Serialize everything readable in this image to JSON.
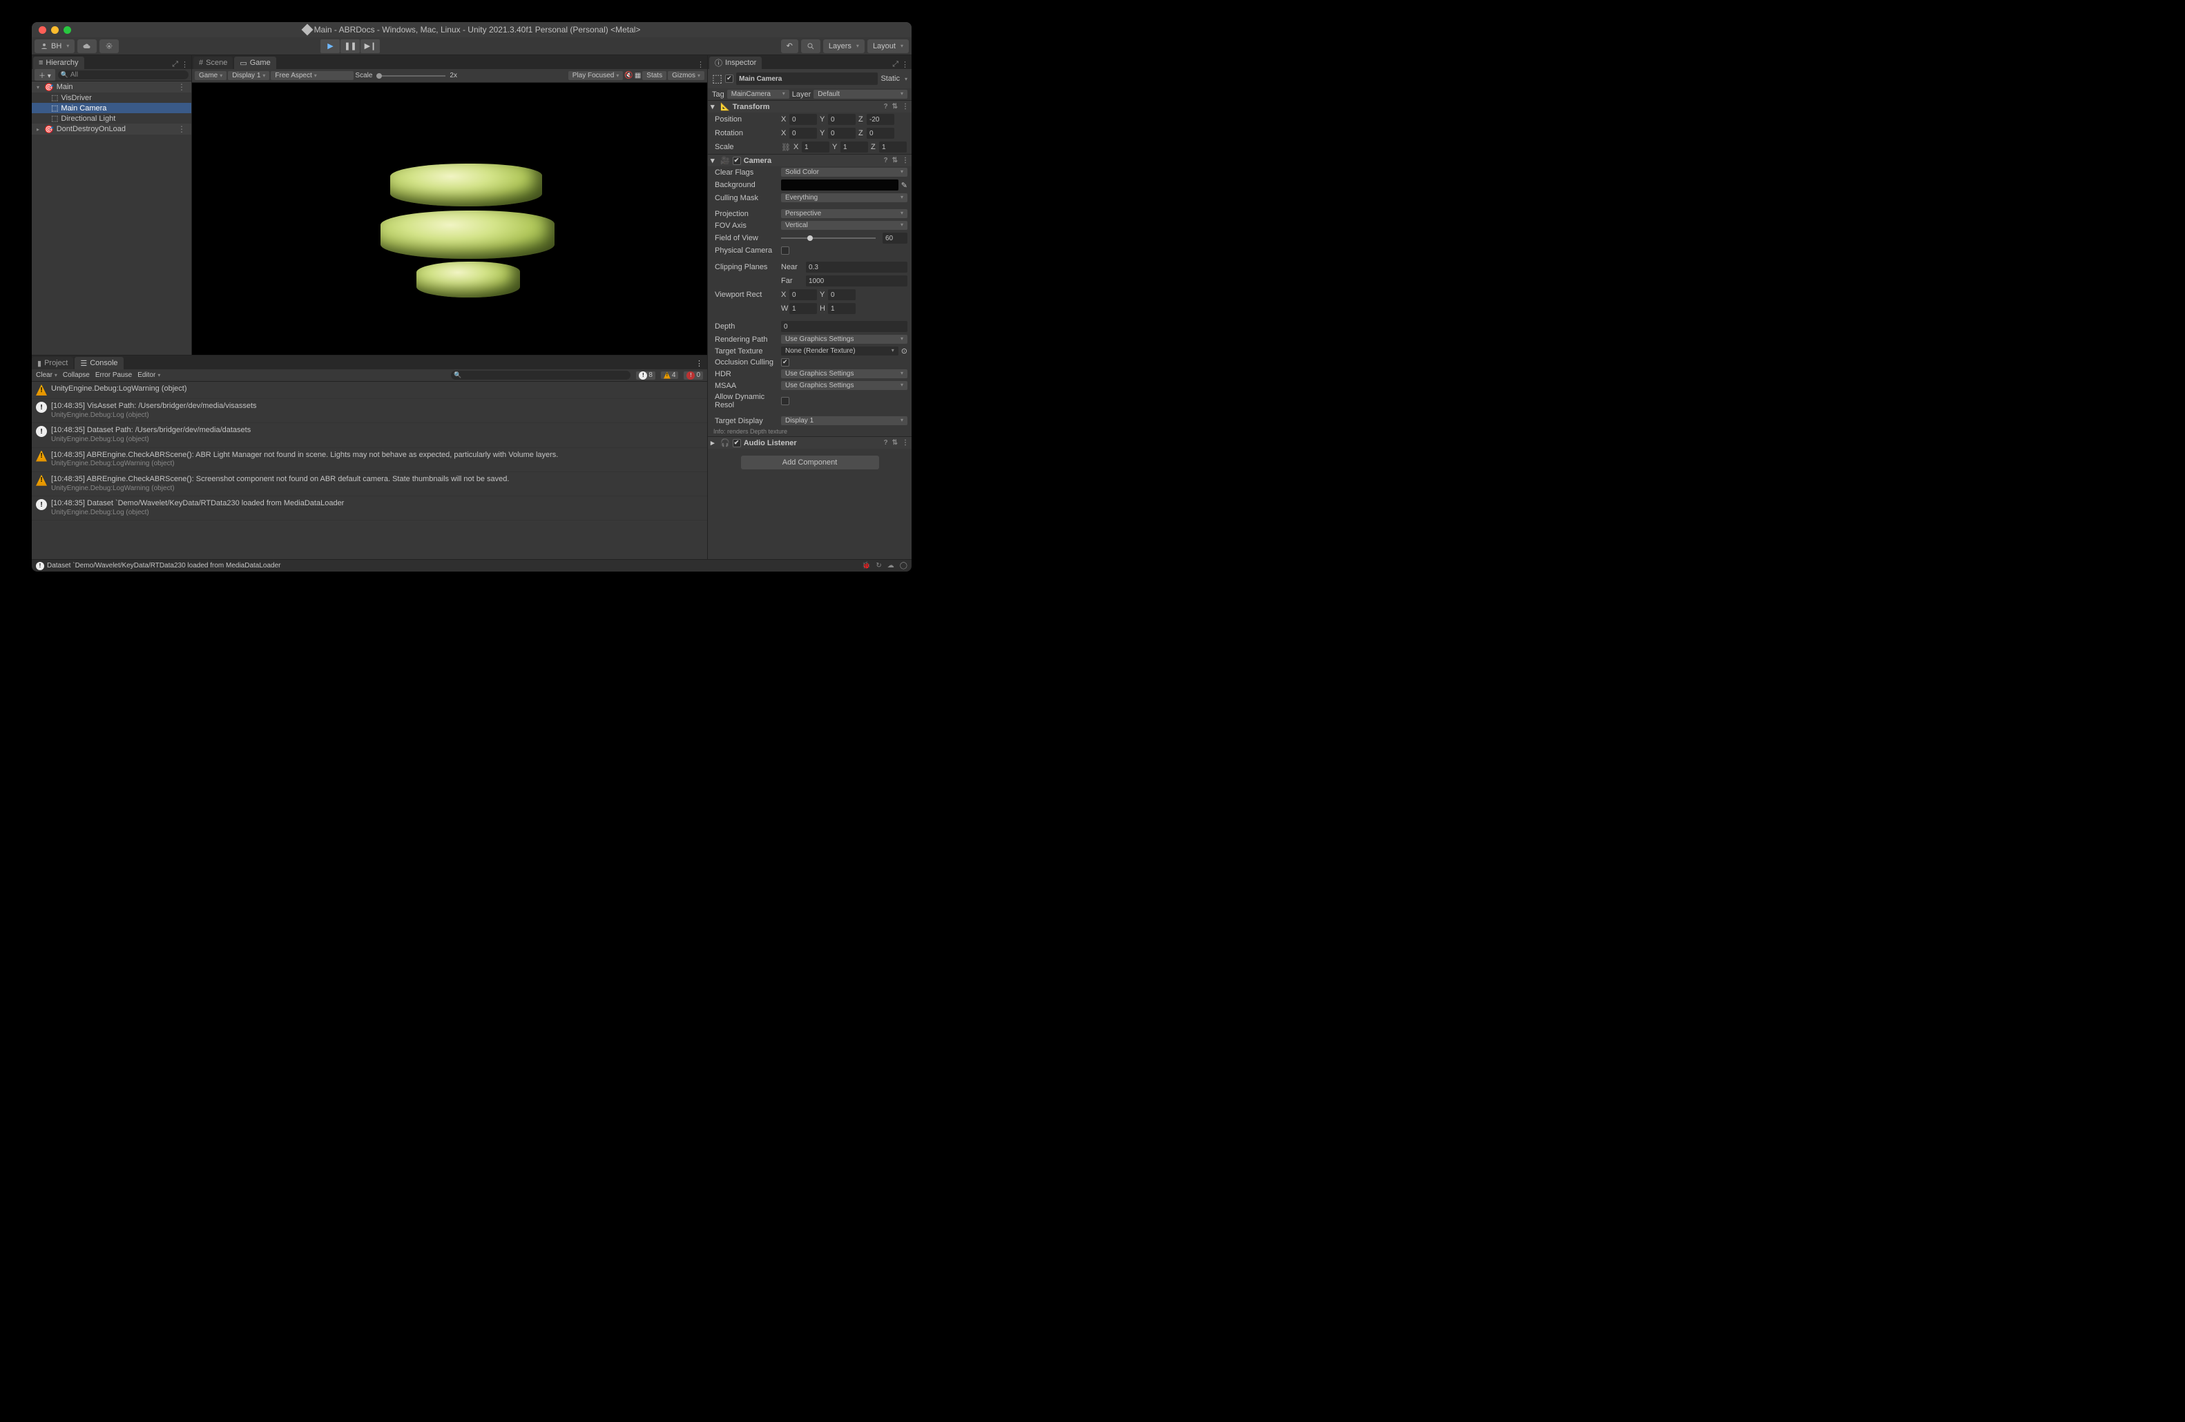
{
  "window": {
    "title": "Main - ABRDocs - Windows, Mac, Linux - Unity 2021.3.40f1 Personal (Personal) <Metal>"
  },
  "account": {
    "label": "BH"
  },
  "layers": "Layers",
  "layout": "Layout",
  "hierarchy": {
    "tab": "Hierarchy",
    "search_placeholder": "All",
    "items": [
      {
        "name": "Main",
        "kind": "scene"
      },
      {
        "name": "VisDriver",
        "indent": 1
      },
      {
        "name": "Main Camera",
        "indent": 1,
        "selected": true
      },
      {
        "name": "Directional Light",
        "indent": 1
      },
      {
        "name": "DontDestroyOnLoad",
        "kind": "scene-aux"
      }
    ]
  },
  "center": {
    "tabs": [
      {
        "label": "Scene",
        "active": false,
        "icon": "grid"
      },
      {
        "label": "Game",
        "active": true,
        "icon": "display"
      }
    ],
    "gamebar": {
      "mode": "Game",
      "display": "Display 1",
      "aspect": "Free Aspect",
      "scale_label": "Scale",
      "scale_value": "2x",
      "play_focus": "Play Focused",
      "stats": "Stats",
      "gizmos": "Gizmos"
    }
  },
  "bottom": {
    "tabs": [
      {
        "label": "Project",
        "active": false,
        "icon": "folder"
      },
      {
        "label": "Console",
        "active": true,
        "icon": "console"
      }
    ],
    "toolbar": {
      "clear": "Clear",
      "collapse": "Collapse",
      "error_pause": "Error Pause",
      "editor": "Editor",
      "counts": {
        "info": 8,
        "warn": 4,
        "err": 0
      }
    },
    "logs": [
      {
        "type": "warn",
        "line1": "UnityEngine.Debug:LogWarning (object)"
      },
      {
        "type": "info",
        "line1": "[10:48:35] VisAsset Path: /Users/bridger/dev/media/visassets",
        "line2": "UnityEngine.Debug:Log (object)"
      },
      {
        "type": "info",
        "line1": "[10:48:35] Dataset Path: /Users/bridger/dev/media/datasets",
        "line2": "UnityEngine.Debug:Log (object)"
      },
      {
        "type": "warn",
        "line1": "[10:48:35] ABREngine.CheckABRScene(): ABR Light Manager not found in scene. Lights may not behave as expected, particularly with Volume layers.",
        "line2": "UnityEngine.Debug:LogWarning (object)"
      },
      {
        "type": "warn",
        "line1": "[10:48:35] ABREngine.CheckABRScene(): Screenshot component not found on ABR default camera. State thumbnails will not be saved.",
        "line2": "UnityEngine.Debug:LogWarning (object)"
      },
      {
        "type": "info",
        "line1": "[10:48:35] Dataset `Demo/Wavelet/KeyData/RTData230 loaded from MediaDataLoader",
        "line2": "UnityEngine.Debug:Log (object)"
      }
    ]
  },
  "inspector": {
    "tab": "Inspector",
    "object": {
      "enabled": true,
      "name": "Main Camera",
      "static": "Static"
    },
    "tagrow": {
      "tag_label": "Tag",
      "tag": "MainCamera",
      "layer_label": "Layer",
      "layer": "Default"
    },
    "transform": {
      "title": "Transform",
      "pos_label": "Position",
      "rot_label": "Rotation",
      "scl_label": "Scale",
      "pos": {
        "x": "0",
        "y": "0",
        "z": "-20"
      },
      "rot": {
        "x": "0",
        "y": "0",
        "z": "0"
      },
      "scl": {
        "x": "1",
        "y": "1",
        "z": "1"
      }
    },
    "camera": {
      "title": "Camera",
      "clear_flags_label": "Clear Flags",
      "clear_flags": "Solid Color",
      "background_label": "Background",
      "culling_label": "Culling Mask",
      "culling": "Everything",
      "projection_label": "Projection",
      "projection": "Perspective",
      "fov_axis_label": "FOV Axis",
      "fov_axis": "Vertical",
      "fov_label": "Field of View",
      "fov": "60",
      "phys_label": "Physical Camera",
      "clip_label": "Clipping Planes",
      "near_label": "Near",
      "near": "0.3",
      "far_label": "Far",
      "far": "1000",
      "viewport_label": "Viewport Rect",
      "viewport": {
        "x": "0",
        "y": "0",
        "w": "1",
        "h": "1"
      },
      "depth_label": "Depth",
      "depth": "0",
      "render_path_label": "Rendering Path",
      "render_path": "Use Graphics Settings",
      "target_tex_label": "Target Texture",
      "target_tex": "None (Render Texture)",
      "occlusion_label": "Occlusion Culling",
      "hdr_label": "HDR",
      "hdr": "Use Graphics Settings",
      "msaa_label": "MSAA",
      "msaa": "Use Graphics Settings",
      "dynres_label": "Allow Dynamic Resol",
      "target_disp_label": "Target Display",
      "target_disp": "Display 1",
      "info": "Info: renders Depth texture"
    },
    "audio": {
      "title": "Audio Listener"
    },
    "add_component": "Add Component"
  },
  "status": {
    "msg": "Dataset `Demo/Wavelet/KeyData/RTData230 loaded from MediaDataLoader"
  },
  "icons": {
    "x_label": "X",
    "y_label": "Y",
    "z_label": "Z",
    "w_label": "W",
    "h_label": "H"
  }
}
